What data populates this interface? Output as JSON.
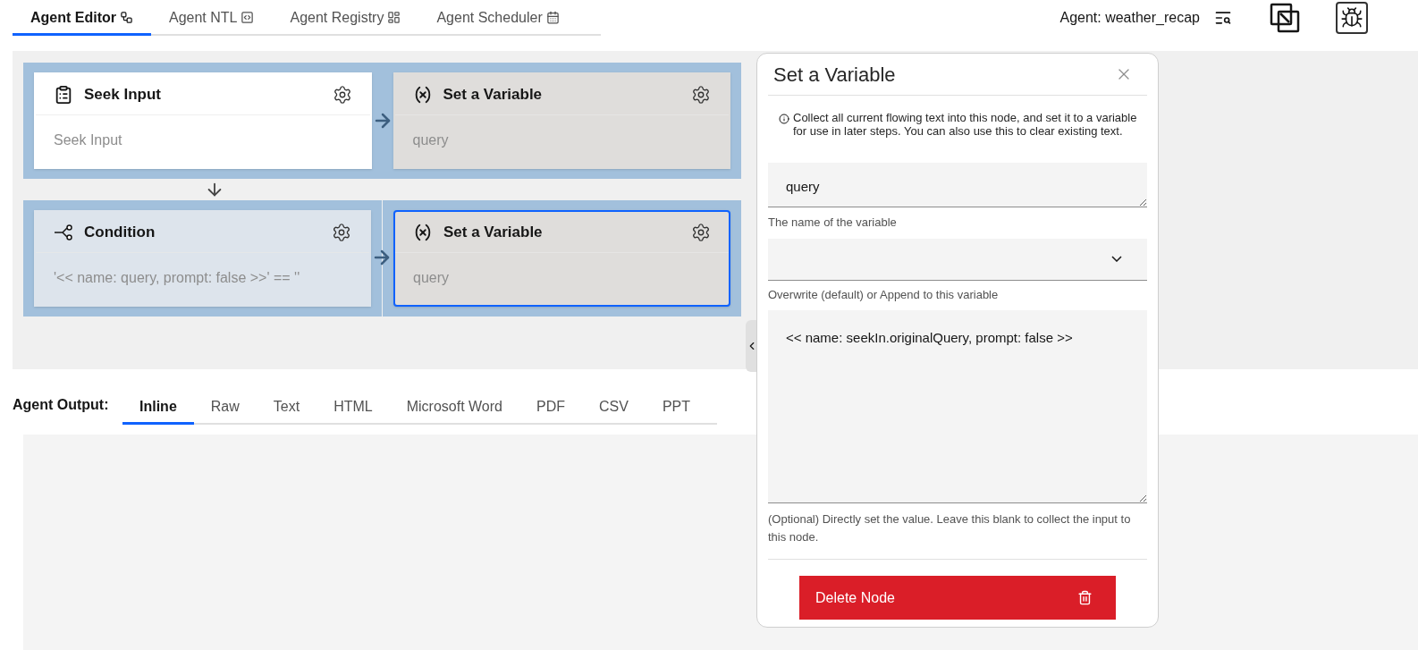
{
  "top_tabs": [
    {
      "label": "Agent Editor",
      "selected": true
    },
    {
      "label": "Agent NTL",
      "selected": false
    },
    {
      "label": "Agent Registry",
      "selected": false
    },
    {
      "label": "Agent Scheduler",
      "selected": false
    }
  ],
  "agent_label": "Agent: weather_recap",
  "flow": {
    "rows": [
      {
        "groups": [
          {
            "nodes": [
              {
                "kind": "seek_input",
                "title": "Seek Input",
                "body": "Seek Input",
                "selected": false
              },
              {
                "kind": "set_variable",
                "title": "Set a Variable",
                "body": "query",
                "selected": false
              }
            ]
          }
        ]
      },
      {
        "groups": [
          {
            "nodes": [
              {
                "kind": "condition",
                "title": "Condition",
                "body": "'<< name: query, prompt: false >>' == ''",
                "selected": false
              }
            ]
          },
          {
            "nodes": [
              {
                "kind": "set_variable",
                "title": "Set a Variable",
                "body": "query",
                "selected": true
              }
            ]
          }
        ]
      }
    ]
  },
  "output": {
    "label": "Agent Output:",
    "tabs": [
      {
        "label": "Inline",
        "selected": true
      },
      {
        "label": "Raw",
        "selected": false
      },
      {
        "label": "Text",
        "selected": false
      },
      {
        "label": "HTML",
        "selected": false
      },
      {
        "label": "Microsoft Word",
        "selected": false
      },
      {
        "label": "PDF",
        "selected": false
      },
      {
        "label": "CSV",
        "selected": false
      },
      {
        "label": "PPT",
        "selected": false
      }
    ]
  },
  "panel": {
    "title": "Set a Variable",
    "info": "Collect all current flowing text into this node, and set it to a variable for use in later steps. You can also use this to clear existing text.",
    "fields": [
      {
        "kind": "text",
        "value": "query",
        "label": "The name of the variable"
      },
      {
        "kind": "select",
        "label": "Overwrite (default) or Append to this variable"
      },
      {
        "kind": "textarea",
        "value": "<< name: seekIn.originalQuery, prompt: false >>",
        "help": "(Optional) Directly set the value. Leave this blank to collect the input to this node."
      }
    ],
    "delete_button": "Delete Node"
  }
}
